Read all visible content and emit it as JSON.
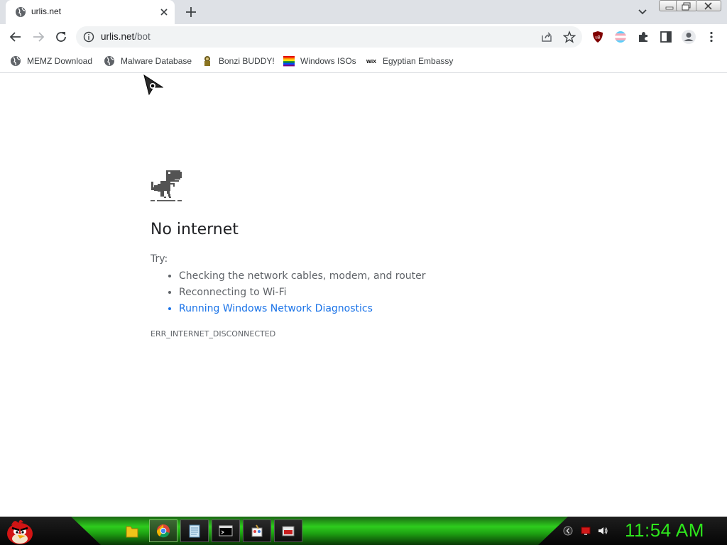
{
  "tab": {
    "title": "urlis.net",
    "favicon": "globe-icon"
  },
  "omnibox": {
    "url_host": "urlis.net",
    "url_path": "/bot"
  },
  "bookmarks": [
    {
      "label": "MEMZ Download",
      "icon": "globe-icon"
    },
    {
      "label": "Malware Database",
      "icon": "globe-icon"
    },
    {
      "label": "Bonzi BUDDY!",
      "icon": "bonzi-icon"
    },
    {
      "label": "Windows ISOs",
      "icon": "rainbow-flag-icon"
    },
    {
      "label": "Egyptian Embassy",
      "icon": "wix-icon"
    }
  ],
  "bookmark_wix_text": "WiX",
  "error": {
    "title": "No internet",
    "try_label": "Try:",
    "suggestions": [
      "Checking the network cables, modem, and router",
      "Reconnecting to Wi-Fi",
      "Running Windows Network Diagnostics"
    ],
    "code": "ERR_INTERNET_DISCONNECTED"
  },
  "extensions": {
    "ublock_text": "uB"
  },
  "taskbar": {
    "clock": "11:54 AM",
    "accent": "#2ee51c",
    "apps": [
      "folder-icon",
      "chrome-icon",
      "notepad-icon",
      "cmd-icon",
      "paint-icon",
      "video-icon"
    ]
  },
  "colors": {
    "link": "#1a73e8",
    "tabstrip": "#dee1e6"
  }
}
